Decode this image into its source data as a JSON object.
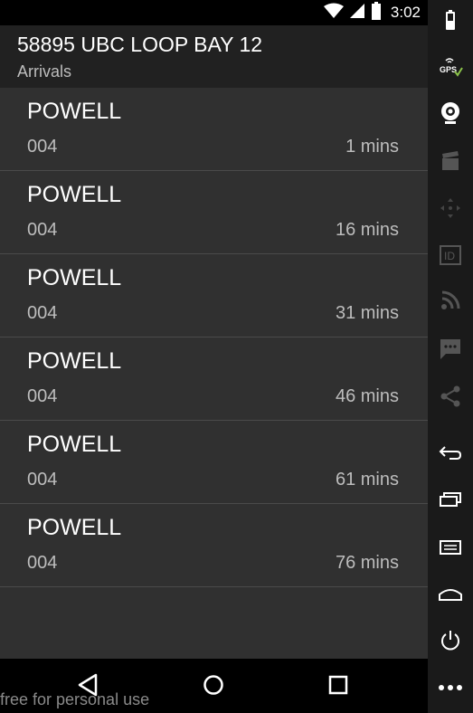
{
  "status_bar": {
    "time": "3:02",
    "icons": [
      "wifi-icon",
      "cell-signal-icon",
      "battery-icon"
    ]
  },
  "header": {
    "title": "58895 UBC LOOP BAY 12",
    "subtitle": "Arrivals"
  },
  "arrivals": [
    {
      "name": "POWELL",
      "route": "004",
      "time": "1 mins"
    },
    {
      "name": "POWELL",
      "route": "004",
      "time": "16 mins"
    },
    {
      "name": "POWELL",
      "route": "004",
      "time": "31 mins"
    },
    {
      "name": "POWELL",
      "route": "004",
      "time": "46 mins"
    },
    {
      "name": "POWELL",
      "route": "004",
      "time": "61 mins"
    },
    {
      "name": "POWELL",
      "route": "004",
      "time": "76 mins"
    }
  ],
  "nav_bar": {
    "icons": [
      "back-icon",
      "home-icon",
      "recents-icon"
    ]
  },
  "watermark": "free for personal use",
  "emulator_toolbar": {
    "gps_label": "GPS",
    "id_label": "ID",
    "icons": [
      "battery-icon",
      "gps-icon",
      "camera-icon",
      "clapperboard-icon",
      "dpad-icon",
      "id-icon",
      "rss-icon",
      "message-icon",
      "share-icon",
      "back-icon",
      "recents-icon",
      "menu-icon",
      "home-icon",
      "power-icon",
      "more-icon"
    ]
  },
  "colors": {
    "background": "#303030",
    "action_bar": "#212121",
    "divider": "#4a4a4a",
    "text_primary": "#ffffff",
    "text_secondary": "#bdbdbd"
  }
}
